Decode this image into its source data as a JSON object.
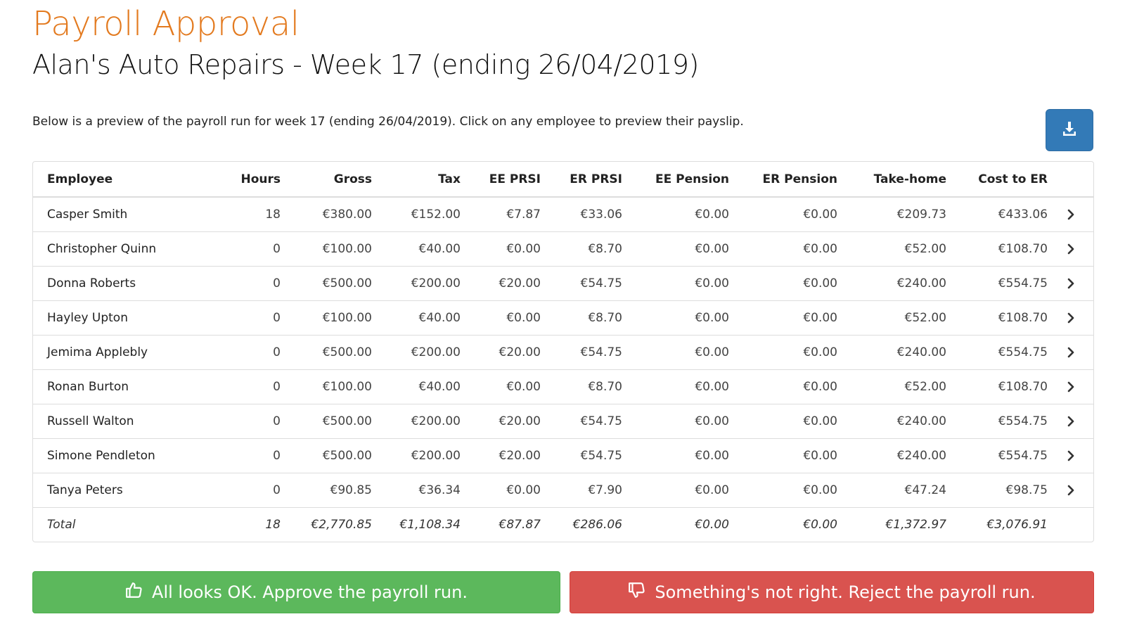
{
  "header": {
    "title": "Payroll Approval",
    "subtitle": "Alan's Auto Repairs - Week 17 (ending 26/04/2019)"
  },
  "intro_text": "Below is a preview of the payroll run for week 17 (ending 26/04/2019). Click on any employee to preview their payslip.",
  "download_icon": "download-icon",
  "colors": {
    "title": "#e37a1f",
    "download_button": "#337ab7",
    "approve_button": "#5cb85c",
    "reject_button": "#d9534f"
  },
  "table": {
    "columns": [
      "Employee",
      "Hours",
      "Gross",
      "Tax",
      "EE PRSI",
      "ER PRSI",
      "EE Pension",
      "ER Pension",
      "Take-home",
      "Cost to ER"
    ],
    "rows": [
      [
        "Casper Smith",
        "18",
        "€380.00",
        "€152.00",
        "€7.87",
        "€33.06",
        "€0.00",
        "€0.00",
        "€209.73",
        "€433.06"
      ],
      [
        "Christopher Quinn",
        "0",
        "€100.00",
        "€40.00",
        "€0.00",
        "€8.70",
        "€0.00",
        "€0.00",
        "€52.00",
        "€108.70"
      ],
      [
        "Donna Roberts",
        "0",
        "€500.00",
        "€200.00",
        "€20.00",
        "€54.75",
        "€0.00",
        "€0.00",
        "€240.00",
        "€554.75"
      ],
      [
        "Hayley Upton",
        "0",
        "€100.00",
        "€40.00",
        "€0.00",
        "€8.70",
        "€0.00",
        "€0.00",
        "€52.00",
        "€108.70"
      ],
      [
        "Jemima Applebly",
        "0",
        "€500.00",
        "€200.00",
        "€20.00",
        "€54.75",
        "€0.00",
        "€0.00",
        "€240.00",
        "€554.75"
      ],
      [
        "Ronan Burton",
        "0",
        "€100.00",
        "€40.00",
        "€0.00",
        "€8.70",
        "€0.00",
        "€0.00",
        "€52.00",
        "€108.70"
      ],
      [
        "Russell Walton",
        "0",
        "€500.00",
        "€200.00",
        "€20.00",
        "€54.75",
        "€0.00",
        "€0.00",
        "€240.00",
        "€554.75"
      ],
      [
        "Simone Pendleton",
        "0",
        "€500.00",
        "€200.00",
        "€20.00",
        "€54.75",
        "€0.00",
        "€0.00",
        "€240.00",
        "€554.75"
      ],
      [
        "Tanya Peters",
        "0",
        "€90.85",
        "€36.34",
        "€0.00",
        "€7.90",
        "€0.00",
        "€0.00",
        "€47.24",
        "€98.75"
      ]
    ],
    "total": [
      "Total",
      "18",
      "€2,770.85",
      "€1,108.34",
      "€87.87",
      "€286.06",
      "€0.00",
      "€0.00",
      "€1,372.97",
      "€3,076.91"
    ],
    "row_icon": "chevron-right-icon"
  },
  "actions": {
    "approve_label": "All looks OK. Approve the payroll run.",
    "approve_icon": "thumbs-up-icon",
    "reject_label": "Something's not right. Reject the payroll run.",
    "reject_icon": "thumbs-down-icon"
  }
}
